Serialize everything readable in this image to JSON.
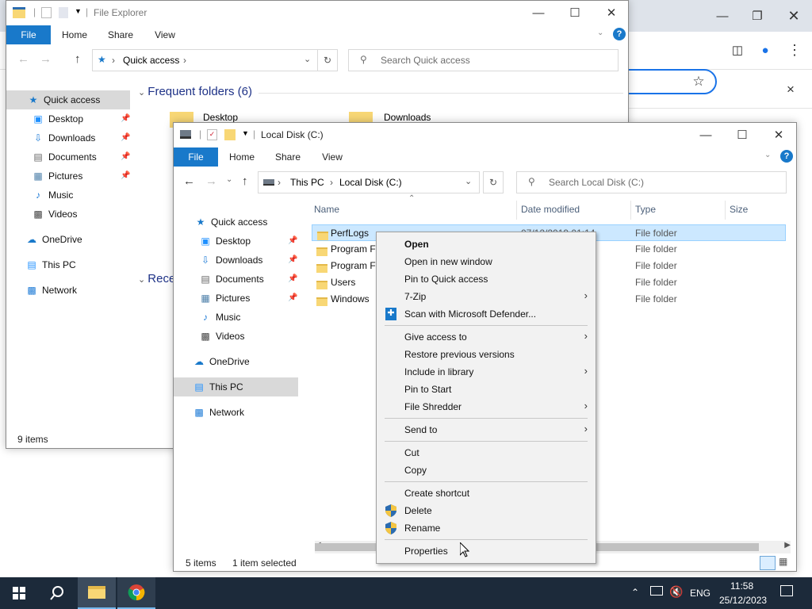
{
  "chrome": {
    "close_glyph": "×"
  },
  "back_window": {
    "title": "File Explorer",
    "tabs": [
      "File",
      "Home",
      "Share",
      "View"
    ],
    "address": "Quick access",
    "search_placeholder": "Search Quick access",
    "nav": [
      {
        "label": "Quick access",
        "icon": "star-icon"
      },
      {
        "label": "Desktop",
        "icon": "desktop-icon",
        "pinned": true
      },
      {
        "label": "Downloads",
        "icon": "download-icon",
        "pinned": true
      },
      {
        "label": "Documents",
        "icon": "document-icon",
        "pinned": true
      },
      {
        "label": "Pictures",
        "icon": "picture-icon",
        "pinned": true
      },
      {
        "label": "Music",
        "icon": "music-icon"
      },
      {
        "label": "Videos",
        "icon": "video-icon"
      },
      {
        "label": "OneDrive",
        "icon": "cloud-icon"
      },
      {
        "label": "This PC",
        "icon": "computer-icon"
      },
      {
        "label": "Network",
        "icon": "network-icon"
      }
    ],
    "frequent_header": "Frequent folders (6)",
    "frequent_items": [
      "Desktop",
      "Downloads"
    ],
    "recent_header": "Rece",
    "status": "9 items"
  },
  "front_window": {
    "title": "Local Disk (C:)",
    "tabs": [
      "File",
      "Home",
      "Share",
      "View"
    ],
    "breadcrumb": [
      "This PC",
      "Local Disk (C:)"
    ],
    "search_placeholder": "Search Local Disk (C:)",
    "nav": [
      {
        "label": "Quick access",
        "icon": "star-icon"
      },
      {
        "label": "Desktop",
        "icon": "desktop-icon",
        "pinned": true
      },
      {
        "label": "Downloads",
        "icon": "download-icon",
        "pinned": true
      },
      {
        "label": "Documents",
        "icon": "document-icon",
        "pinned": true
      },
      {
        "label": "Pictures",
        "icon": "picture-icon",
        "pinned": true
      },
      {
        "label": "Music",
        "icon": "music-icon"
      },
      {
        "label": "Videos",
        "icon": "video-icon"
      },
      {
        "label": "OneDrive",
        "icon": "cloud-icon"
      },
      {
        "label": "This PC",
        "icon": "computer-icon",
        "selected": true
      },
      {
        "label": "Network",
        "icon": "network-icon"
      }
    ],
    "columns": [
      "Name",
      "Date modified",
      "Type",
      "Size"
    ],
    "rows": [
      {
        "name": "PerfLogs",
        "date": "07/12/2019 01:14",
        "type": "File folder",
        "selected": true
      },
      {
        "name": "Program Fi",
        "date": "",
        "type": "File folder"
      },
      {
        "name": "Program Fi",
        "date": "",
        "type": "File folder"
      },
      {
        "name": "Users",
        "date": "",
        "type": "File folder"
      },
      {
        "name": "Windows",
        "date": "",
        "type": "File folder"
      }
    ],
    "status_count": "5 items",
    "status_selected": "1 item selected"
  },
  "context_menu": {
    "items": [
      {
        "label": "Open",
        "bold": true
      },
      {
        "label": "Open in new window"
      },
      {
        "label": "Pin to Quick access"
      },
      {
        "label": "7-Zip",
        "submenu": true
      },
      {
        "label": "Scan with Microsoft Defender...",
        "icon": "defender-icon"
      },
      {
        "sep": true
      },
      {
        "label": "Give access to",
        "submenu": true
      },
      {
        "label": "Restore previous versions"
      },
      {
        "label": "Include in library",
        "submenu": true
      },
      {
        "label": "Pin to Start"
      },
      {
        "label": "File Shredder",
        "submenu": true
      },
      {
        "sep": true
      },
      {
        "label": "Send to",
        "submenu": true
      },
      {
        "sep": true
      },
      {
        "label": "Cut"
      },
      {
        "label": "Copy"
      },
      {
        "sep": true
      },
      {
        "label": "Create shortcut"
      },
      {
        "label": "Delete",
        "icon": "shield-icon"
      },
      {
        "label": "Rename",
        "icon": "shield-icon"
      },
      {
        "sep": true
      },
      {
        "label": "Properties"
      }
    ]
  },
  "taskbar": {
    "language": "ENG",
    "time": "11:58",
    "date": "25/12/2023"
  },
  "colors": {
    "accent": "#1979ca",
    "selection": "#cce8ff",
    "taskbar": "#1c2a3a"
  }
}
